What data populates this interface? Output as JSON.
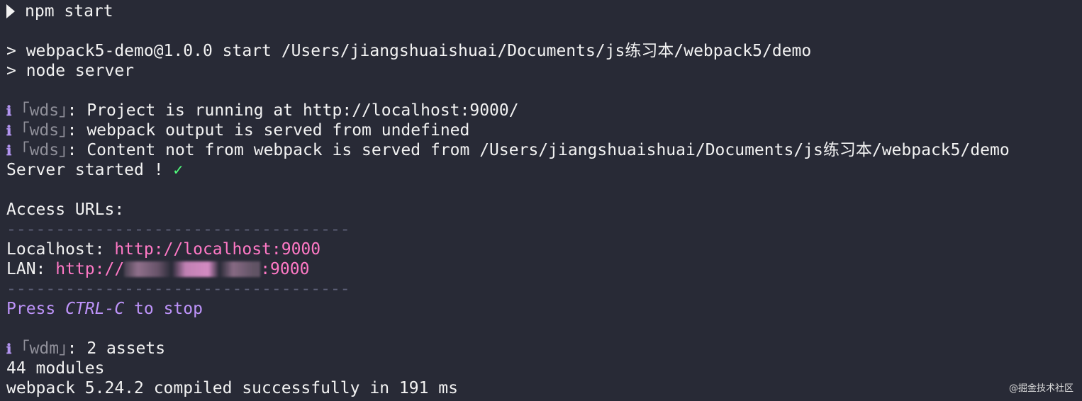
{
  "terminal": {
    "command": "npm start",
    "script_header": "> webpack5-demo@1.0.0 start /Users/jiangshuaishuai/Documents/js练习本/webpack5/demo",
    "script_cmd": "> node server",
    "info_icon": "ℹ",
    "wds_tag": "｢wds｣",
    "wdm_tag": "｢wdm｣",
    "wds_lines": [
      ": Project is running at http://localhost:9000/",
      ": webpack output is served from undefined",
      ": Content not from webpack is served from /Users/jiangshuaishuai/Documents/js练习本/webpack5/demo"
    ],
    "server_started": "Server started ! ",
    "check_mark": "✓",
    "access_urls": "Access URLs:",
    "divider": "-----------------------------------",
    "localhost_label": "Localhost: ",
    "localhost_url": "http://localhost:9000",
    "lan_label": "LAN: ",
    "lan_url_prefix": "http://",
    "lan_url_suffix": ":9000",
    "press_prefix": "Press ",
    "press_key": "CTRL-C",
    "press_suffix": " to stop",
    "wdm_assets": ": 2 assets",
    "modules": "44 modules",
    "compiled": "webpack 5.24.2 compiled successfully in 191 ms"
  },
  "watermark": "@掘金技术社区",
  "colors": {
    "background": "#282a36",
    "text": "#f2f2f2",
    "url": "#ff79c6",
    "info_icon": "#b294f0",
    "press": "#bd93f9",
    "check": "#50fa7b"
  }
}
